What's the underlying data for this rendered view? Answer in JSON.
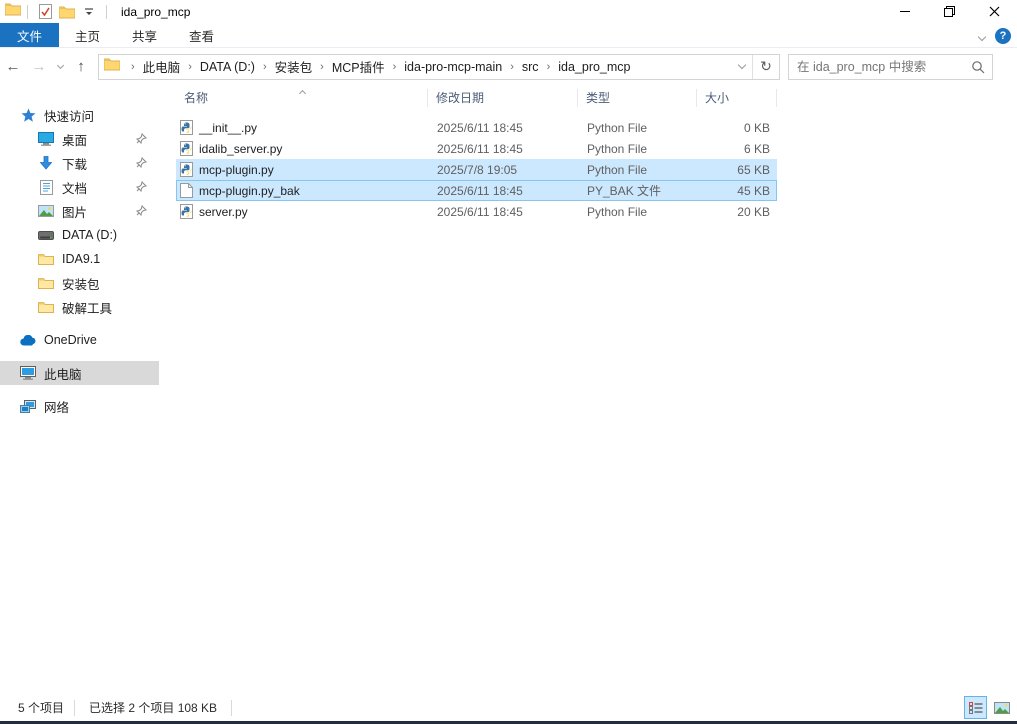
{
  "window": {
    "title": "ida_pro_mcp",
    "controls": {
      "minimize": "minimize",
      "restore": "restore",
      "close": "close"
    }
  },
  "ribbon": {
    "file_tab": "文件",
    "tabs": [
      {
        "label": "主页"
      },
      {
        "label": "共享"
      },
      {
        "label": "查看"
      }
    ],
    "help": "?"
  },
  "navbar": {
    "breadcrumbs": [
      {
        "label": "此电脑"
      },
      {
        "label": "DATA (D:)"
      },
      {
        "label": "安装包"
      },
      {
        "label": "MCP插件"
      },
      {
        "label": "ida-pro-mcp-main"
      },
      {
        "label": "src"
      },
      {
        "label": "ida_pro_mcp"
      }
    ],
    "search_placeholder": "在 ida_pro_mcp 中搜索"
  },
  "sidebar": {
    "quick_access": "快速访问",
    "items": [
      {
        "label": "桌面",
        "pinned": true
      },
      {
        "label": "下载",
        "pinned": true
      },
      {
        "label": "文档",
        "pinned": true
      },
      {
        "label": "图片",
        "pinned": true
      },
      {
        "label": "DATA (D:)",
        "pinned": false
      },
      {
        "label": "IDA9.1",
        "pinned": false
      },
      {
        "label": "安装包",
        "pinned": false
      },
      {
        "label": "破解工具",
        "pinned": false
      }
    ],
    "onedrive": "OneDrive",
    "this_pc": "此电脑",
    "network": "网络"
  },
  "filelist": {
    "columns": {
      "name": "名称",
      "date": "修改日期",
      "type": "类型",
      "size": "大小"
    },
    "rows": [
      {
        "name": "__init__.py",
        "date": "2025/6/11 18:45",
        "type": "Python File",
        "size": "0 KB",
        "selected": false
      },
      {
        "name": "idalib_server.py",
        "date": "2025/6/11 18:45",
        "type": "Python File",
        "size": "6 KB",
        "selected": false
      },
      {
        "name": "mcp-plugin.py",
        "date": "2025/7/8 19:05",
        "type": "Python File",
        "size": "65 KB",
        "selected": true
      },
      {
        "name": "mcp-plugin.py_bak",
        "date": "2025/6/11 18:45",
        "type": "PY_BAK 文件",
        "size": "45 KB",
        "selected": true
      },
      {
        "name": "server.py",
        "date": "2025/6/11 18:45",
        "type": "Python File",
        "size": "20 KB",
        "selected": false
      }
    ]
  },
  "statusbar": {
    "items_count": "5 个项目",
    "selection_info": "已选择 2 个项目  108 KB"
  },
  "colors": {
    "accent_blue": "#1b72c0",
    "selection_fill": "#cce8ff",
    "selection_border": "#84c5f2",
    "sidebar_selected": "#d9d9d9",
    "folder_yellow": "#ffd76e",
    "python_blue": "#3973a6",
    "python_yellow": "#ffd43b"
  }
}
